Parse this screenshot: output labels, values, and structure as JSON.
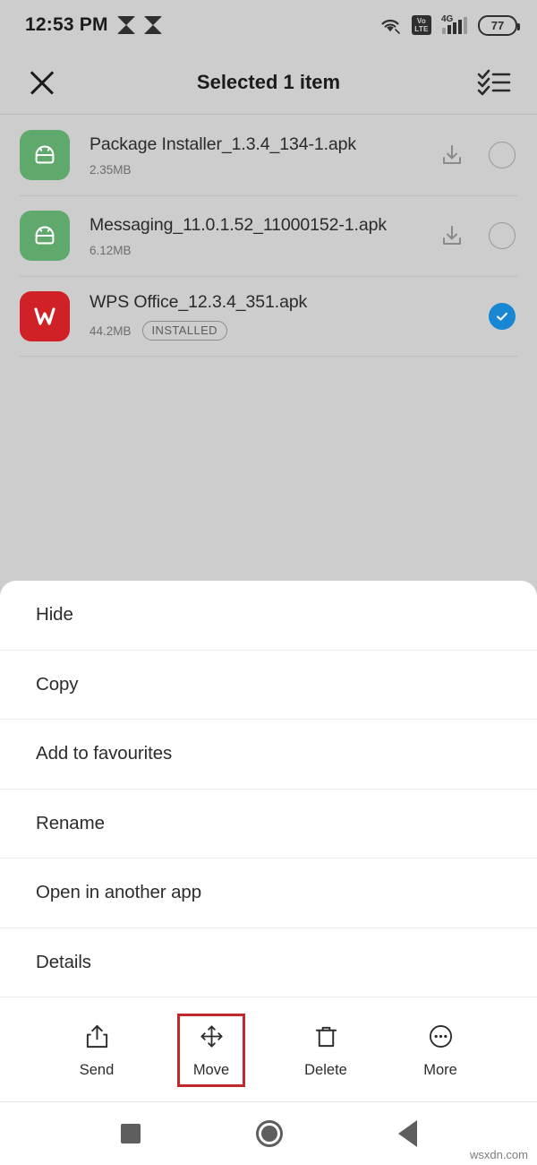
{
  "status_bar": {
    "time": "12:53 PM",
    "app_icons": [
      "app-badge-icon",
      "app-badge-icon"
    ],
    "wifi_icon": "wifi-icon",
    "volte_top": "Vo",
    "volte_bottom": "LTE",
    "network_type": "4G",
    "battery_level": "77"
  },
  "header": {
    "close_icon": "close-icon",
    "title": "Selected 1 item",
    "select_all_icon": "select-all-icon"
  },
  "files": [
    {
      "name": "Package Installer_1.3.4_134-1.apk",
      "size": "2.35MB",
      "badge": "",
      "icon": "apk-android-icon",
      "icon_color": "#60a96d",
      "install_icon": "install-icon",
      "selected": false
    },
    {
      "name": "Messaging_11.0.1.52_11000152-1.apk",
      "size": "6.12MB",
      "badge": "",
      "icon": "apk-android-icon",
      "icon_color": "#60a96d",
      "install_icon": "install-icon",
      "selected": false
    },
    {
      "name": "WPS Office_12.3.4_351.apk",
      "size": "44.2MB",
      "badge": "INSTALLED",
      "icon": "wps-office-icon",
      "icon_color": "#cf2126",
      "install_icon": "",
      "selected": true
    }
  ],
  "menu": {
    "items": [
      {
        "label": "Hide"
      },
      {
        "label": "Copy"
      },
      {
        "label": "Add to favourites"
      },
      {
        "label": "Rename"
      },
      {
        "label": "Open in another app"
      },
      {
        "label": "Details"
      }
    ]
  },
  "toolbar": {
    "items": [
      {
        "label": "Send",
        "icon": "share-icon",
        "highlighted": false
      },
      {
        "label": "Move",
        "icon": "move-arrows-icon",
        "highlighted": true
      },
      {
        "label": "Delete",
        "icon": "trash-icon",
        "highlighted": false
      },
      {
        "label": "More",
        "icon": "more-dots-icon",
        "highlighted": false
      }
    ],
    "highlight_color": "#c0282d"
  },
  "nav_bar": {
    "recents_icon": "recents-square-icon",
    "home_icon": "home-circle-icon",
    "back_icon": "back-triangle-icon"
  },
  "watermark": "wsxdn.com",
  "colors": {
    "background": "#cdcdcd",
    "sheet": "#ffffff",
    "accent_selected": "#1787d4",
    "apk_green": "#60a96d",
    "wps_red": "#cf2126"
  }
}
